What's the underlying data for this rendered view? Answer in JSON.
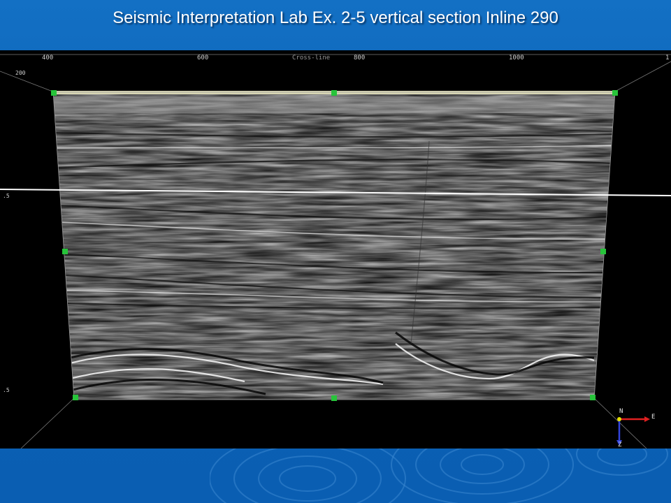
{
  "slide": {
    "title": "Seismic Interpretation Lab Ex. 2-5 vertical section Inline 290"
  },
  "viewer": {
    "axis_title": "Cross-line",
    "top_ticks": [
      "400",
      "600",
      "800",
      "1000",
      "1"
    ],
    "left_ticks": [
      "200",
      ".5",
      ".5"
    ],
    "compass": {
      "north": "N",
      "east": "E",
      "down": "Z"
    },
    "colors": {
      "background": "#000000",
      "handle": "#27c43a",
      "frame_top": "#d8d6b4",
      "horizon": "#ffffff",
      "compass_red": "#e02020",
      "compass_blue": "#3344dd",
      "compass_yellow": "#e6e000"
    }
  }
}
